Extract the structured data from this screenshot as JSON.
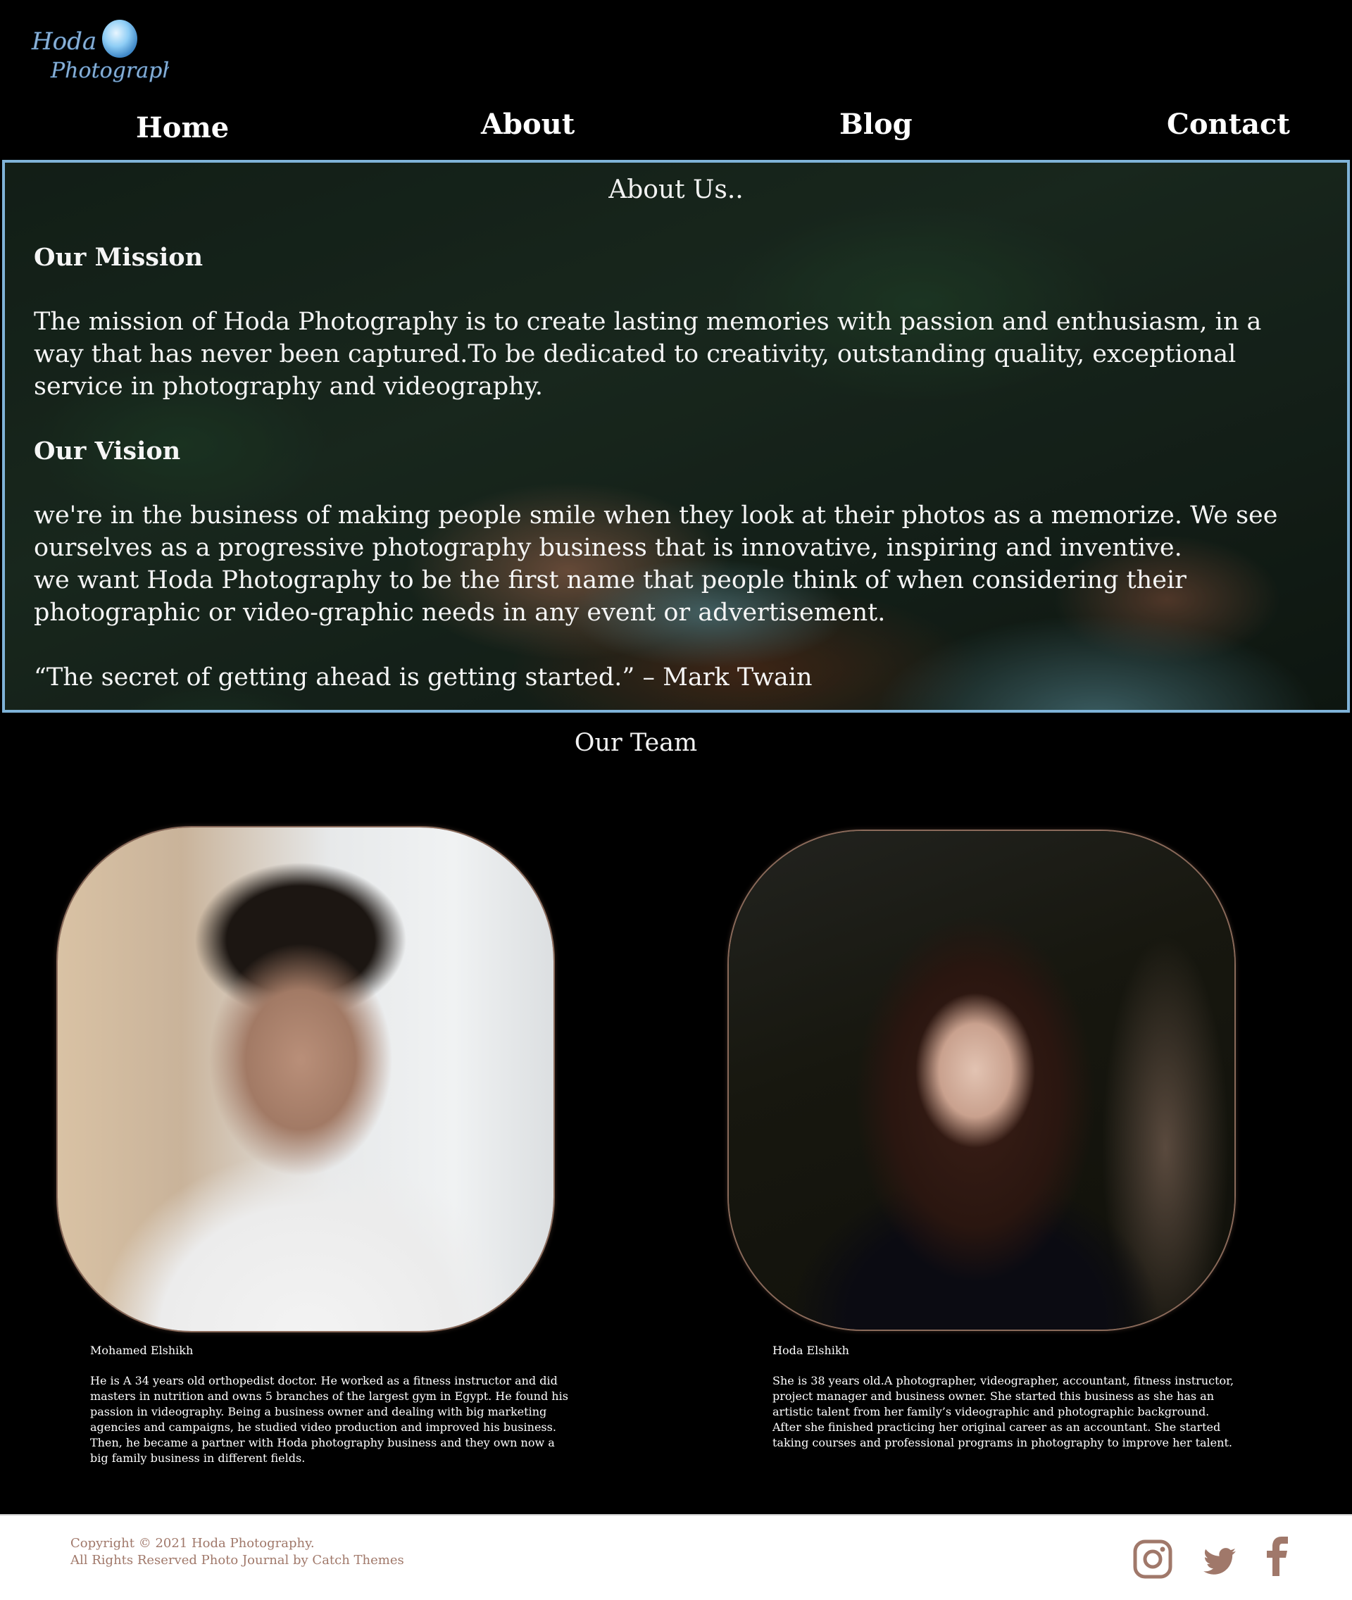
{
  "logo": {
    "line1": "Hoda",
    "line2": "Photography"
  },
  "nav": {
    "home": "Home",
    "about": "About",
    "blog": "Blog",
    "contact": "Contact"
  },
  "about": {
    "title": "About Us..",
    "mission_heading": "Our Mission",
    "mission_text": "The mission of Hoda Photography is to create lasting memories with passion and enthusiasm, in a way that has never been captured.To be dedicated to creativity, outstanding quality, exceptional service in photography and videography.",
    "vision_heading": "Our Vision",
    "vision_text_1": "we're in the business of making people smile when they look at their photos as a memorize. We see ourselves as a progressive photography business that is innovative, inspiring and inventive.",
    "vision_text_2": "we want Hoda Photography to be the first name that people think of when considering their photographic or video-graphic needs in any event or advertisement.",
    "quote": "“The secret of getting ahead is getting started.” – Mark Twain"
  },
  "team": {
    "title": "Our Team",
    "members": [
      {
        "name": "Mohamed Elshikh",
        "bio": "He is A 34 years old orthopedist doctor. He worked as a fitness instructor and did masters in nutrition and owns 5 branches of the largest gym in Egypt. He found his passion in videography. Being a business owner and dealing with big marketing agencies and campaigns, he studied video production and improved his business.\nThen, he became a partner with Hoda photography business and they own now a big family business in different fields."
      },
      {
        "name": "Hoda Elshikh",
        "bio": "She is 38 years old.A photographer, videographer, accountant, fitness instructor, project manager and business owner. She started this business as she has an artistic talent from her family’s videographic and photographic background. After she finished practicing her original career as an accountant. She started taking courses and professional programs in photography to improve her talent."
      }
    ]
  },
  "footer": {
    "copyright": "Copyright © 2021 Hoda Photography.",
    "rights": "All Rights Reserved Photo Journal by Catch Themes",
    "accent_color": "#a0786a",
    "social_icons": [
      "instagram-icon",
      "twitter-icon",
      "facebook-icon"
    ]
  }
}
